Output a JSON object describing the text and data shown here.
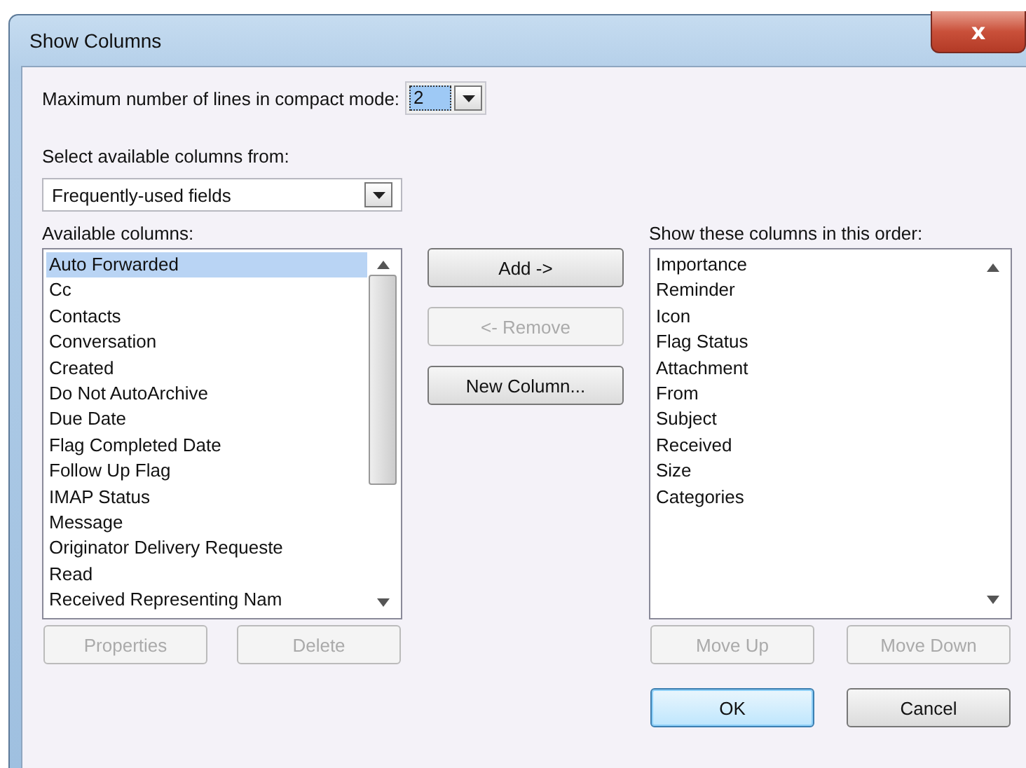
{
  "window": {
    "title": "Show Columns",
    "close_label": "x"
  },
  "compact_lines": {
    "label": "Maximum number of lines in compact mode:",
    "value": "2",
    "selected": true
  },
  "source": {
    "label": "Select available columns from:",
    "value": "Frequently-used fields"
  },
  "available": {
    "label": "Available columns:",
    "items": [
      {
        "text": "Auto Forwarded",
        "selected": true
      },
      {
        "text": "Cc",
        "selected": false
      },
      {
        "text": "Contacts",
        "selected": false
      },
      {
        "text": "Conversation",
        "selected": false
      },
      {
        "text": "Created",
        "selected": false
      },
      {
        "text": "Do Not AutoArchive",
        "selected": false
      },
      {
        "text": "Due Date",
        "selected": false
      },
      {
        "text": "Flag Completed Date",
        "selected": false
      },
      {
        "text": "Follow Up Flag",
        "selected": false
      },
      {
        "text": "IMAP Status",
        "selected": false
      },
      {
        "text": "Message",
        "selected": false
      },
      {
        "text": "Originator Delivery Requeste",
        "selected": false
      },
      {
        "text": "Read",
        "selected": false
      },
      {
        "text": "Received Representing Nam",
        "selected": false
      }
    ],
    "buttons": [
      {
        "label": "Properties",
        "disabled": true
      },
      {
        "label": "Delete",
        "disabled": true
      }
    ]
  },
  "middle_buttons": [
    {
      "label": "Add ->",
      "disabled": false
    },
    {
      "label": "<- Remove",
      "disabled": true
    },
    {
      "label": "New Column...",
      "disabled": false
    }
  ],
  "shown": {
    "label": "Show these columns in this order:",
    "items": [
      {
        "text": "Importance",
        "selected": false
      },
      {
        "text": "Reminder",
        "selected": false
      },
      {
        "text": "Icon",
        "selected": false
      },
      {
        "text": "Flag Status",
        "selected": false
      },
      {
        "text": "Attachment",
        "selected": false
      },
      {
        "text": "From",
        "selected": false
      },
      {
        "text": "Subject",
        "selected": false
      },
      {
        "text": "Received",
        "selected": false
      },
      {
        "text": "Size",
        "selected": false
      },
      {
        "text": "Categories",
        "selected": false
      }
    ],
    "buttons": [
      {
        "label": "Move Up",
        "disabled": true
      },
      {
        "label": "Move Down",
        "disabled": true
      }
    ]
  },
  "footer_buttons": [
    {
      "label": "OK",
      "default": true,
      "disabled": false
    },
    {
      "label": "Cancel",
      "default": false,
      "disabled": false
    }
  ]
}
